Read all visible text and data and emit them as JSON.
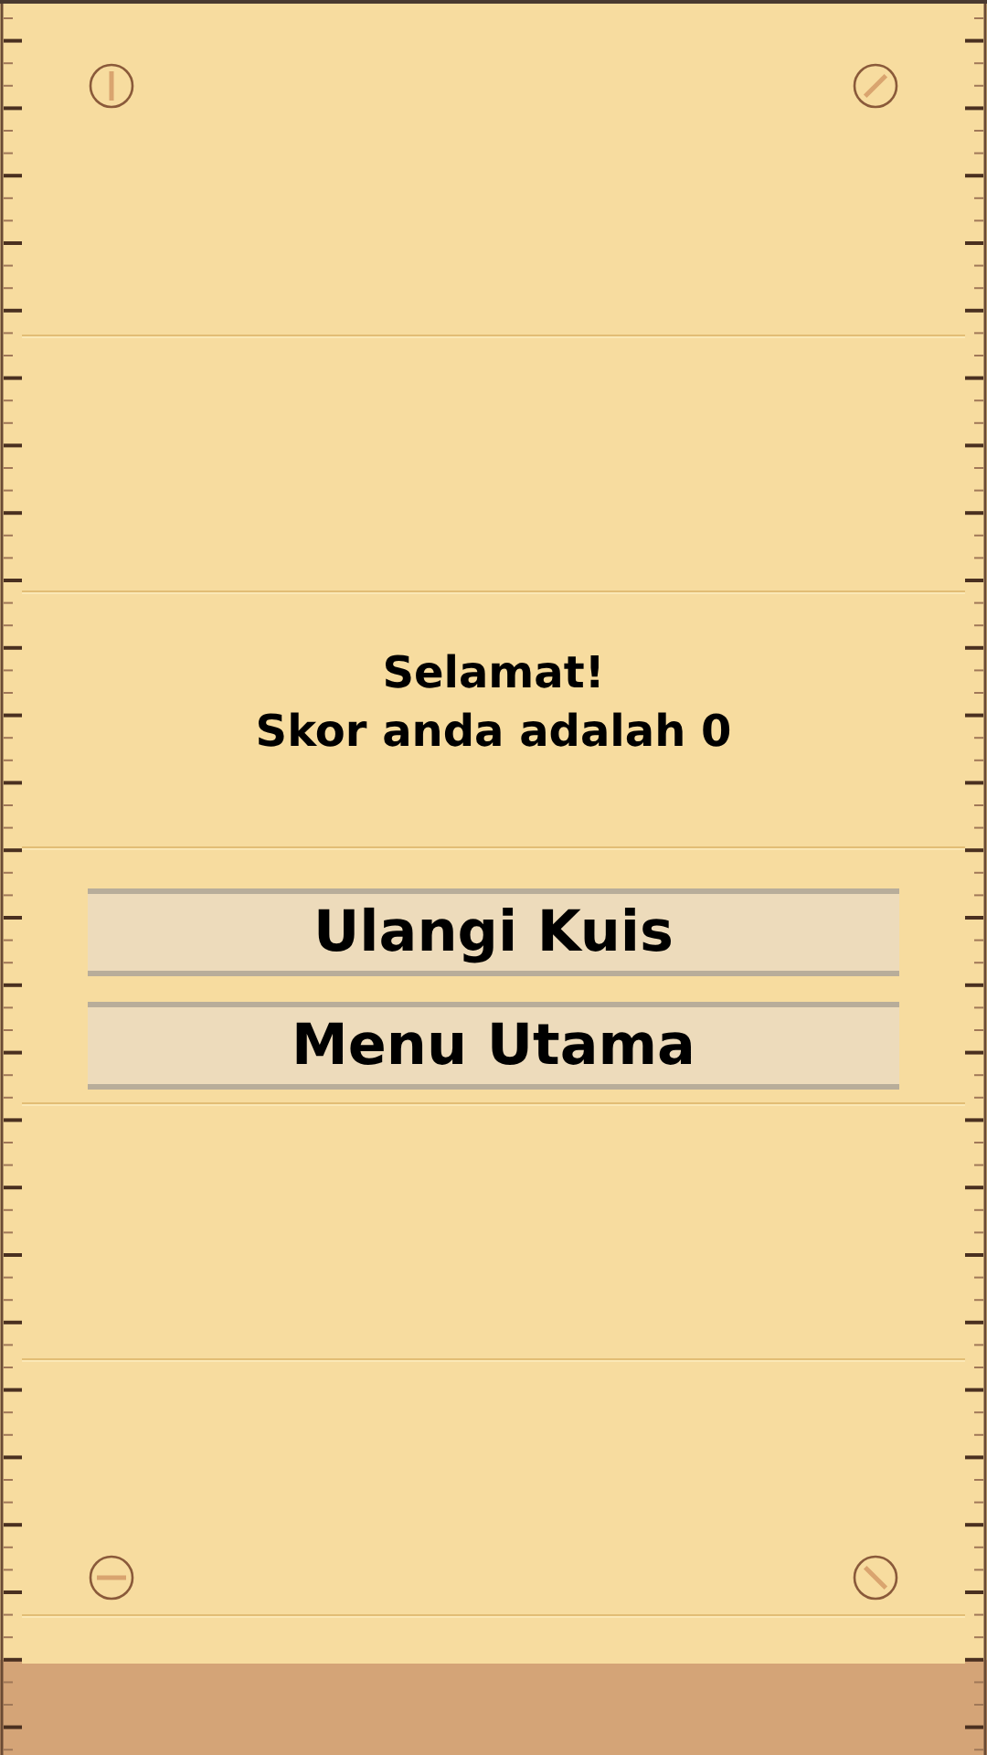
{
  "result": {
    "title": "Selamat!",
    "score_text": "Skor anda adalah 0"
  },
  "buttons": [
    {
      "label": "Ulangi Kuis"
    },
    {
      "label": "Menu Utama"
    }
  ]
}
